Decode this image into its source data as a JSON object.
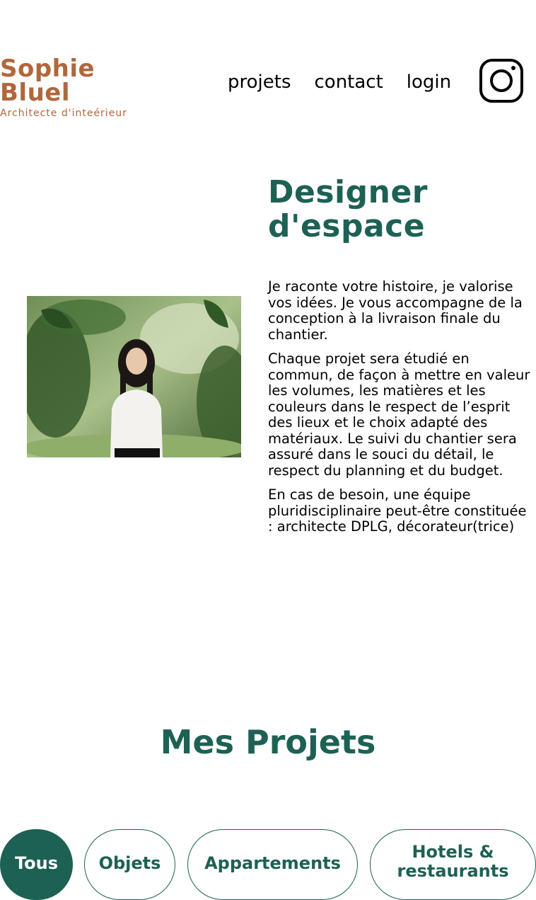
{
  "brand": {
    "line1": "Sophie",
    "line2": "Bluel",
    "subtitle": "Architecte d'inteérieur"
  },
  "nav": {
    "items": [
      "projets",
      "contact",
      "login"
    ],
    "instagram_icon": "instagram-icon"
  },
  "intro": {
    "title_line1": "Designer",
    "title_line2": "d'espace",
    "photo_alt": "Portrait",
    "paragraphs": [
      "Je raconte votre histoire, je valorise vos idées. Je vous accompagne de la conception à la livraison finale du chantier.",
      "Chaque projet sera étudié en commun, de façon à mettre en valeur les volumes, les matières et les couleurs dans le respect de l’esprit des lieux et le choix adapté des matériaux. Le suivi du chantier sera assuré dans le souci du détail, le respect du planning et du budget.",
      "En cas de besoin, une équipe pluridisciplinaire peut-être constituée : architecte DPLG, décorateur(trice)"
    ]
  },
  "projects": {
    "title": "Mes Projets",
    "filters": [
      {
        "label": "Tous",
        "active": true
      },
      {
        "label": "Objets",
        "active": false
      },
      {
        "label": "Appartements",
        "active": false
      },
      {
        "label": "Hotels & restaurants",
        "active": false
      }
    ]
  },
  "colors": {
    "brand": "#B1663C",
    "accent": "#1D6154"
  }
}
